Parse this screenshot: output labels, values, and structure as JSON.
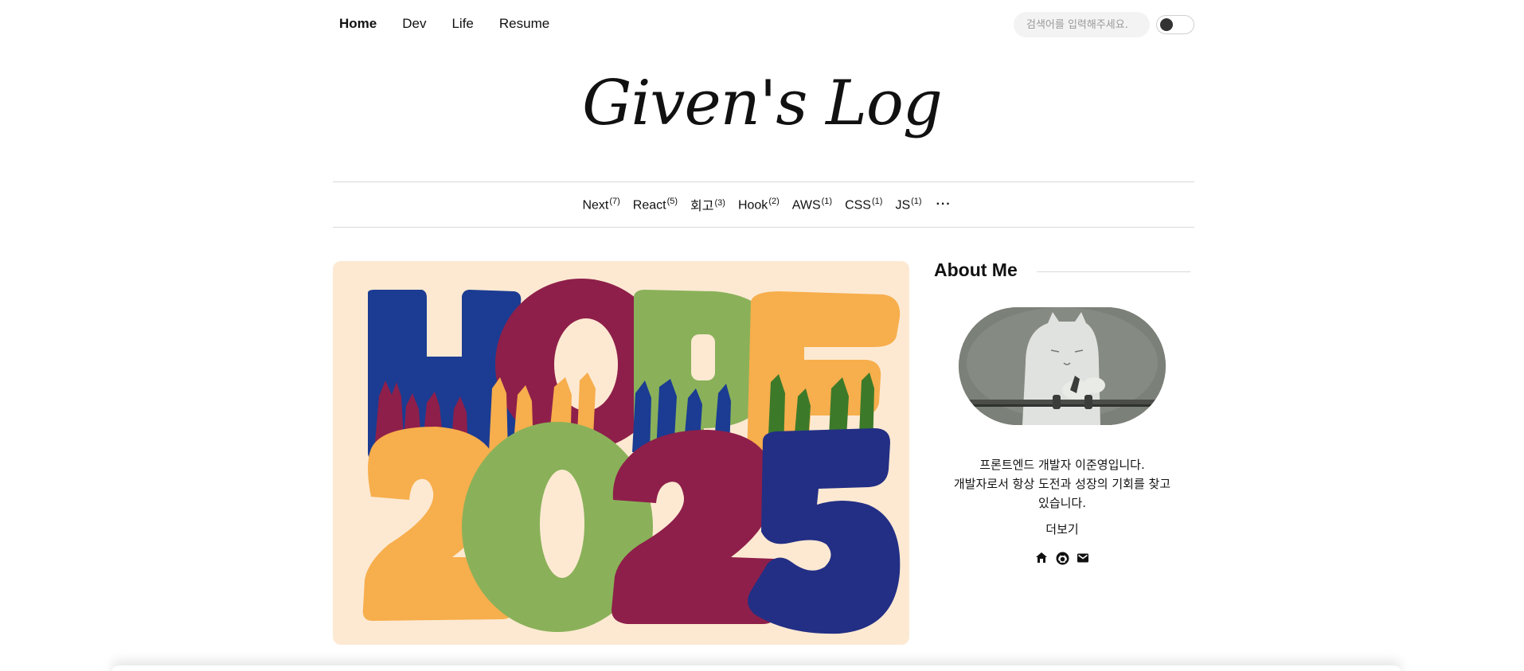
{
  "nav": {
    "links": [
      {
        "label": "Home",
        "active": true
      },
      {
        "label": "Dev"
      },
      {
        "label": "Life"
      },
      {
        "label": "Resume"
      }
    ],
    "search_placeholder": "검색어를 입력해주세요.",
    "theme_toggle_icon": "toggle-switch-icon"
  },
  "logo": {
    "text": "Given's Log"
  },
  "categories": {
    "items": [
      {
        "label": "Next",
        "count": "(7)"
      },
      {
        "label": "React",
        "count": "(5)"
      },
      {
        "label": "회고",
        "count": "(3)"
      },
      {
        "label": "Hook",
        "count": "(2)"
      },
      {
        "label": "AWS",
        "count": "(1)"
      },
      {
        "label": "CSS",
        "count": "(1)"
      },
      {
        "label": "JS",
        "count": "(1)"
      }
    ],
    "more_label": "···"
  },
  "hero": {
    "image_text_top": "HOPE",
    "image_text_bottom": "2025",
    "colors": {
      "background": "#fde9d2",
      "blue": "#1f3b8f",
      "maroon": "#8e1f4a",
      "green": "#8ab159",
      "orange": "#f7ae4c",
      "navy": "#232f85"
    }
  },
  "about": {
    "title": "About Me",
    "bio": "프론트엔드 개발자 이준영입니다.\n개발자로서 항상 도전과 성장의 기회를 찾고\n있습니다.",
    "bio_lines": [
      "프론트엔드 개발자 이준영입니다.",
      "개발자로서 항상 도전과 성장의 기회를 찾고",
      "있습니다."
    ],
    "more_label": "더보기",
    "socials": [
      "home-icon",
      "github-icon",
      "mail-icon"
    ]
  }
}
